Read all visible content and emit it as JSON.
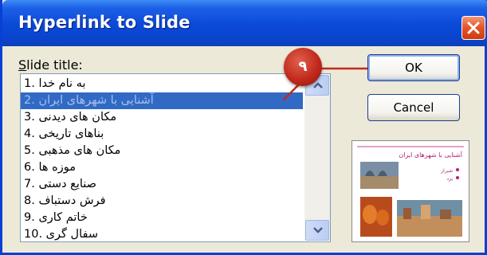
{
  "dialog": {
    "title": "Hyperlink to Slide",
    "close_icon": "close-icon"
  },
  "slide_list": {
    "label_accel": "S",
    "label_rest": "lide title:",
    "items": [
      "به نام خدا .1",
      "آشنایی با شهرهای ایران .2",
      "مکان های دیدنی .3",
      "بناهای تاریخی .4",
      "مکان های مذهبی .5",
      "موزه ها .6",
      "صنایع دستی .7",
      "فرش دستباف .8",
      "خاتم کاری .9",
      "سفال گری .10"
    ],
    "selected_index": 1
  },
  "buttons": {
    "ok": "OK",
    "cancel": "Cancel"
  },
  "preview": {
    "heading": "آشنایی با شهرهای ایران",
    "bullet_1": "شیراز",
    "bullet_2": "یزد"
  },
  "callout": {
    "number": "۹"
  },
  "colors": {
    "titlebar": "#0a49d8",
    "selection": "#316ac5",
    "callout": "#c12a1c",
    "close": "#e5582c"
  }
}
